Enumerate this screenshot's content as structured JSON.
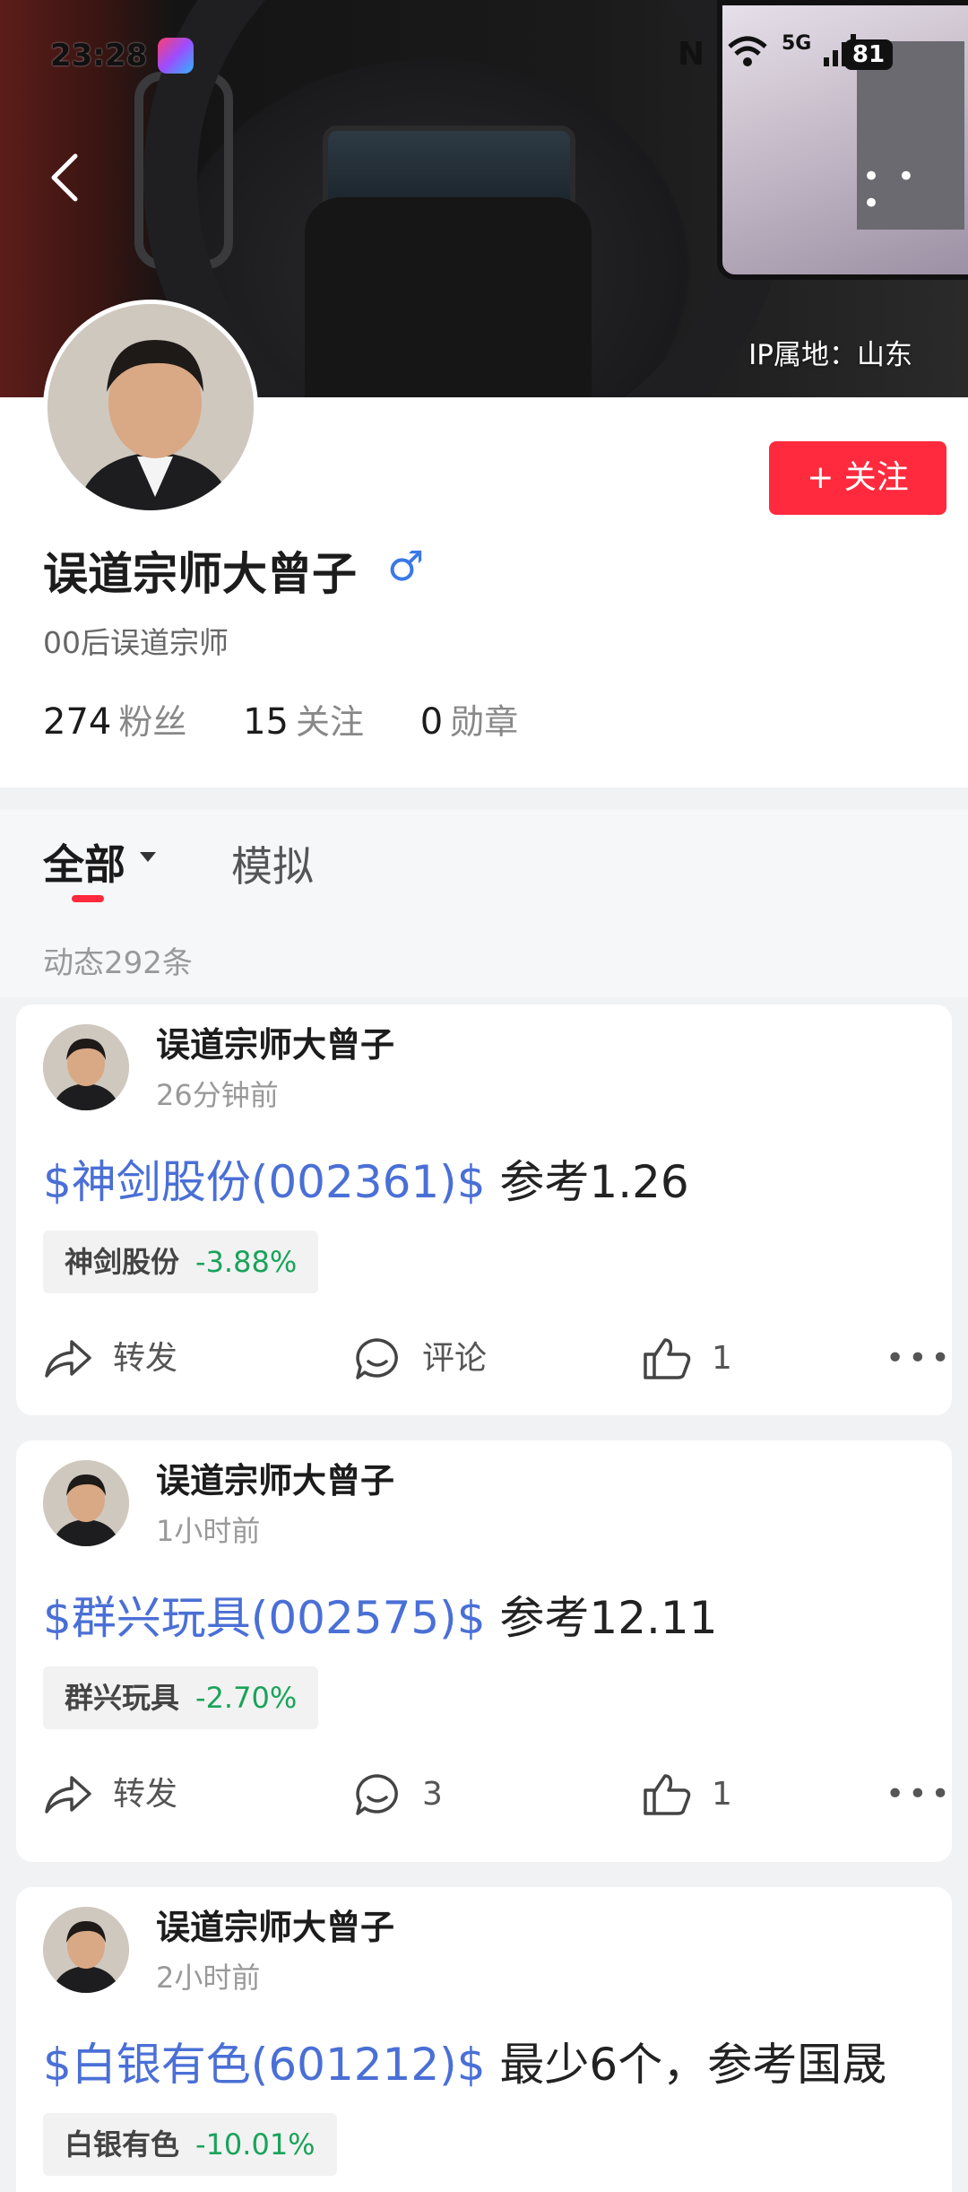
{
  "status_bar": {
    "time": "23:28",
    "nfc": "N",
    "network": "5G",
    "battery": "81"
  },
  "header": {
    "ip_location": "IP属地：山东",
    "more": "• • •"
  },
  "profile": {
    "nickname": "误道宗师大曾子",
    "gender_symbol": "♂",
    "bio": "00后误道宗师",
    "follow_button": "+ 关注",
    "stats": [
      {
        "num": "274",
        "label": "粉丝"
      },
      {
        "num": "15",
        "label": "关注"
      },
      {
        "num": "0",
        "label": "勋章"
      }
    ]
  },
  "tabs": {
    "all": "全部",
    "simulation": "模拟"
  },
  "post_count": "动态292条",
  "posts": [
    {
      "author": "误道宗师大曾子",
      "time": "26分钟前",
      "stock_link": "$神剑股份(002361)$",
      "text": " 参考1.26",
      "chip_name": "神剑股份",
      "chip_pct": "-3.88%",
      "repost": "转发",
      "comment": "评论",
      "likes": "1",
      "more": "•••"
    },
    {
      "author": "误道宗师大曾子",
      "time": "1小时前",
      "stock_link": "$群兴玩具(002575)$",
      "text": " 参考12.11",
      "chip_name": "群兴玩具",
      "chip_pct": "-2.70%",
      "repost": "转发",
      "comment": "3",
      "likes": "1",
      "more": "•••"
    },
    {
      "author": "误道宗师大曾子",
      "time": "2小时前",
      "stock_link": "$白银有色(601212)$",
      "text": " 最少6个，参考国晟",
      "chip_name": "白银有色",
      "chip_pct": "-10.01%"
    }
  ],
  "colors": {
    "accent_red": "#ff2a3d",
    "link_blue": "#4a6fd6",
    "down_green": "#1aa35a"
  }
}
